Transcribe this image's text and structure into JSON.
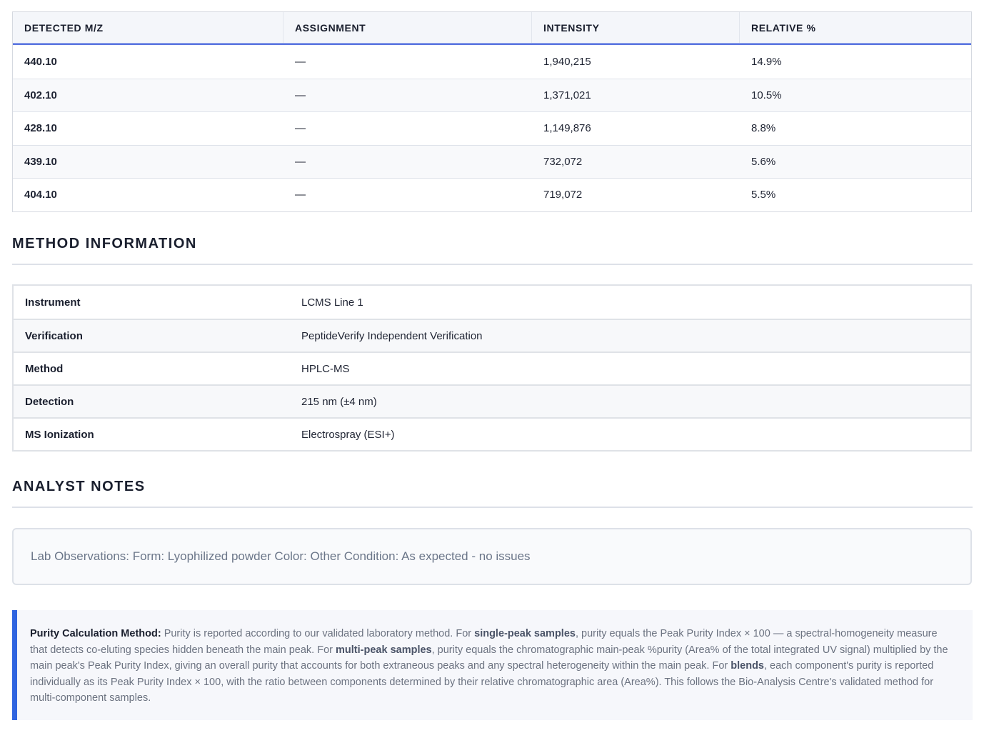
{
  "mass_table": {
    "headers": [
      "DETECTED M/Z",
      "ASSIGNMENT",
      "INTENSITY",
      "RELATIVE %"
    ],
    "rows": [
      {
        "mz": "440.10",
        "assignment": "—",
        "intensity": "1,940,215",
        "relative": "14.9%"
      },
      {
        "mz": "402.10",
        "assignment": "—",
        "intensity": "1,371,021",
        "relative": "10.5%"
      },
      {
        "mz": "428.10",
        "assignment": "—",
        "intensity": "1,149,876",
        "relative": "8.8%"
      },
      {
        "mz": "439.10",
        "assignment": "—",
        "intensity": "732,072",
        "relative": "5.6%"
      },
      {
        "mz": "404.10",
        "assignment": "—",
        "intensity": "719,072",
        "relative": "5.5%"
      }
    ]
  },
  "method": {
    "title": "METHOD INFORMATION",
    "rows": [
      {
        "key": "Instrument",
        "value": "LCMS Line 1"
      },
      {
        "key": "Verification",
        "value": "PeptideVerify Independent Verification"
      },
      {
        "key": "Method",
        "value": "HPLC-MS"
      },
      {
        "key": "Detection",
        "value": "215 nm (±4 nm)"
      },
      {
        "key": "MS Ionization",
        "value": "Electrospray (ESI+)"
      }
    ]
  },
  "notes": {
    "title": "ANALYST NOTES",
    "text": "Lab Observations: Form: Lyophilized powder Color: Other Condition: As expected - no issues"
  },
  "purity": {
    "label": "Purity Calculation Method:",
    "t1": " Purity is reported according to our validated laboratory method. For ",
    "e1": "single-peak samples",
    "t2": ", purity equals the Peak Purity Index × 100 — a spectral-homogeneity measure that detects co-eluting species hidden beneath the main peak. For ",
    "e2": "multi-peak samples",
    "t3": ", purity equals the chromatographic main-peak %purity (Area% of the total integrated UV signal) multiplied by the main peak's Peak Purity Index, giving an overall purity that accounts for both extraneous peaks and any spectral heterogeneity within the main peak. For ",
    "e3": "blends",
    "t4": ", each component's purity is reported individually as its Peak Purity Index × 100, with the ratio between components determined by their relative chromatographic area (Area%). This follows the Bio-Analysis Centre's validated method for multi-component samples."
  },
  "colors": {
    "accent": "#2f64e0",
    "header_bg": "#f4f6fa"
  }
}
